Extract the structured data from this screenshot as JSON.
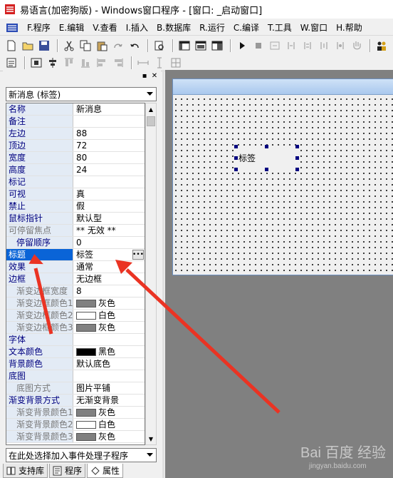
{
  "window": {
    "title": "易语言(加密狗版) - Windows窗口程序 - [窗口: _启动窗口]"
  },
  "menu": [
    "F.程序",
    "E.编辑",
    "V.查看",
    "I.插入",
    "B.数据库",
    "R.运行",
    "C.编译",
    "T.工具",
    "W.窗口",
    "H.帮助"
  ],
  "object_selector": {
    "value": "新消息 (标签)"
  },
  "properties": [
    {
      "name": "名称",
      "value": "新消息",
      "kind": "text"
    },
    {
      "name": "备注",
      "value": "",
      "kind": "text"
    },
    {
      "name": "左边",
      "value": "88",
      "kind": "text"
    },
    {
      "name": "顶边",
      "value": "72",
      "kind": "text"
    },
    {
      "name": "宽度",
      "value": "80",
      "kind": "text"
    },
    {
      "name": "高度",
      "value": "24",
      "kind": "text"
    },
    {
      "name": "标记",
      "value": "",
      "kind": "text"
    },
    {
      "name": "可视",
      "value": "真",
      "kind": "text"
    },
    {
      "name": "禁止",
      "value": "假",
      "kind": "text"
    },
    {
      "name": "鼠标指针",
      "value": "默认型",
      "kind": "text"
    },
    {
      "name": "可停留焦点",
      "value": "** 无效 **",
      "kind": "text",
      "gray": true
    },
    {
      "name": "停留顺序",
      "value": "0",
      "kind": "text",
      "indent": true
    },
    {
      "name": "标题",
      "value": "标签",
      "kind": "text",
      "selected": true
    },
    {
      "name": "效果",
      "value": "通常",
      "kind": "text"
    },
    {
      "name": "边框",
      "value": "无边框",
      "kind": "text"
    },
    {
      "name": "渐变边框宽度",
      "value": "8",
      "kind": "text",
      "gray": true,
      "indent": true
    },
    {
      "name": "渐变边框颜色1",
      "value": "灰色",
      "kind": "color",
      "color": "#808080",
      "gray": true,
      "indent": true
    },
    {
      "name": "渐变边框颜色2",
      "value": "白色",
      "kind": "color",
      "color": "#ffffff",
      "gray": true,
      "indent": true
    },
    {
      "name": "渐变边框颜色3",
      "value": "灰色",
      "kind": "color",
      "color": "#808080",
      "gray": true,
      "indent": true
    },
    {
      "name": "字体",
      "value": "",
      "kind": "text"
    },
    {
      "name": "文本颜色",
      "value": "黑色",
      "kind": "color",
      "color": "#000000"
    },
    {
      "name": "背景颜色",
      "value": "默认底色",
      "kind": "text"
    },
    {
      "name": "底图",
      "value": "",
      "kind": "text"
    },
    {
      "name": "底图方式",
      "value": "图片平铺",
      "kind": "text",
      "gray": true,
      "indent": true
    },
    {
      "name": "渐变背景方式",
      "value": "无渐变背景",
      "kind": "text"
    },
    {
      "name": "渐变背景颜色1",
      "value": "灰色",
      "kind": "color",
      "color": "#808080",
      "gray": true,
      "indent": true
    },
    {
      "name": "渐变背景颜色2",
      "value": "白色",
      "kind": "color",
      "color": "#ffffff",
      "gray": true,
      "indent": true
    },
    {
      "name": "渐变背景颜色3",
      "value": "灰色",
      "kind": "color",
      "color": "#808080",
      "gray": true,
      "indent": true
    }
  ],
  "event_selector": {
    "value": "在此处选择加入事件处理子程序"
  },
  "tabs": [
    "支持库",
    "程序",
    "属性"
  ],
  "design": {
    "label_text": "标签"
  },
  "watermark": {
    "main": "Bai 百度 经验",
    "sub": "jingyan.baidu.com"
  },
  "colors": {
    "selected_row": "#0a64d7",
    "property_name": "#00007f",
    "annotation_arrow": "#ea3323"
  }
}
